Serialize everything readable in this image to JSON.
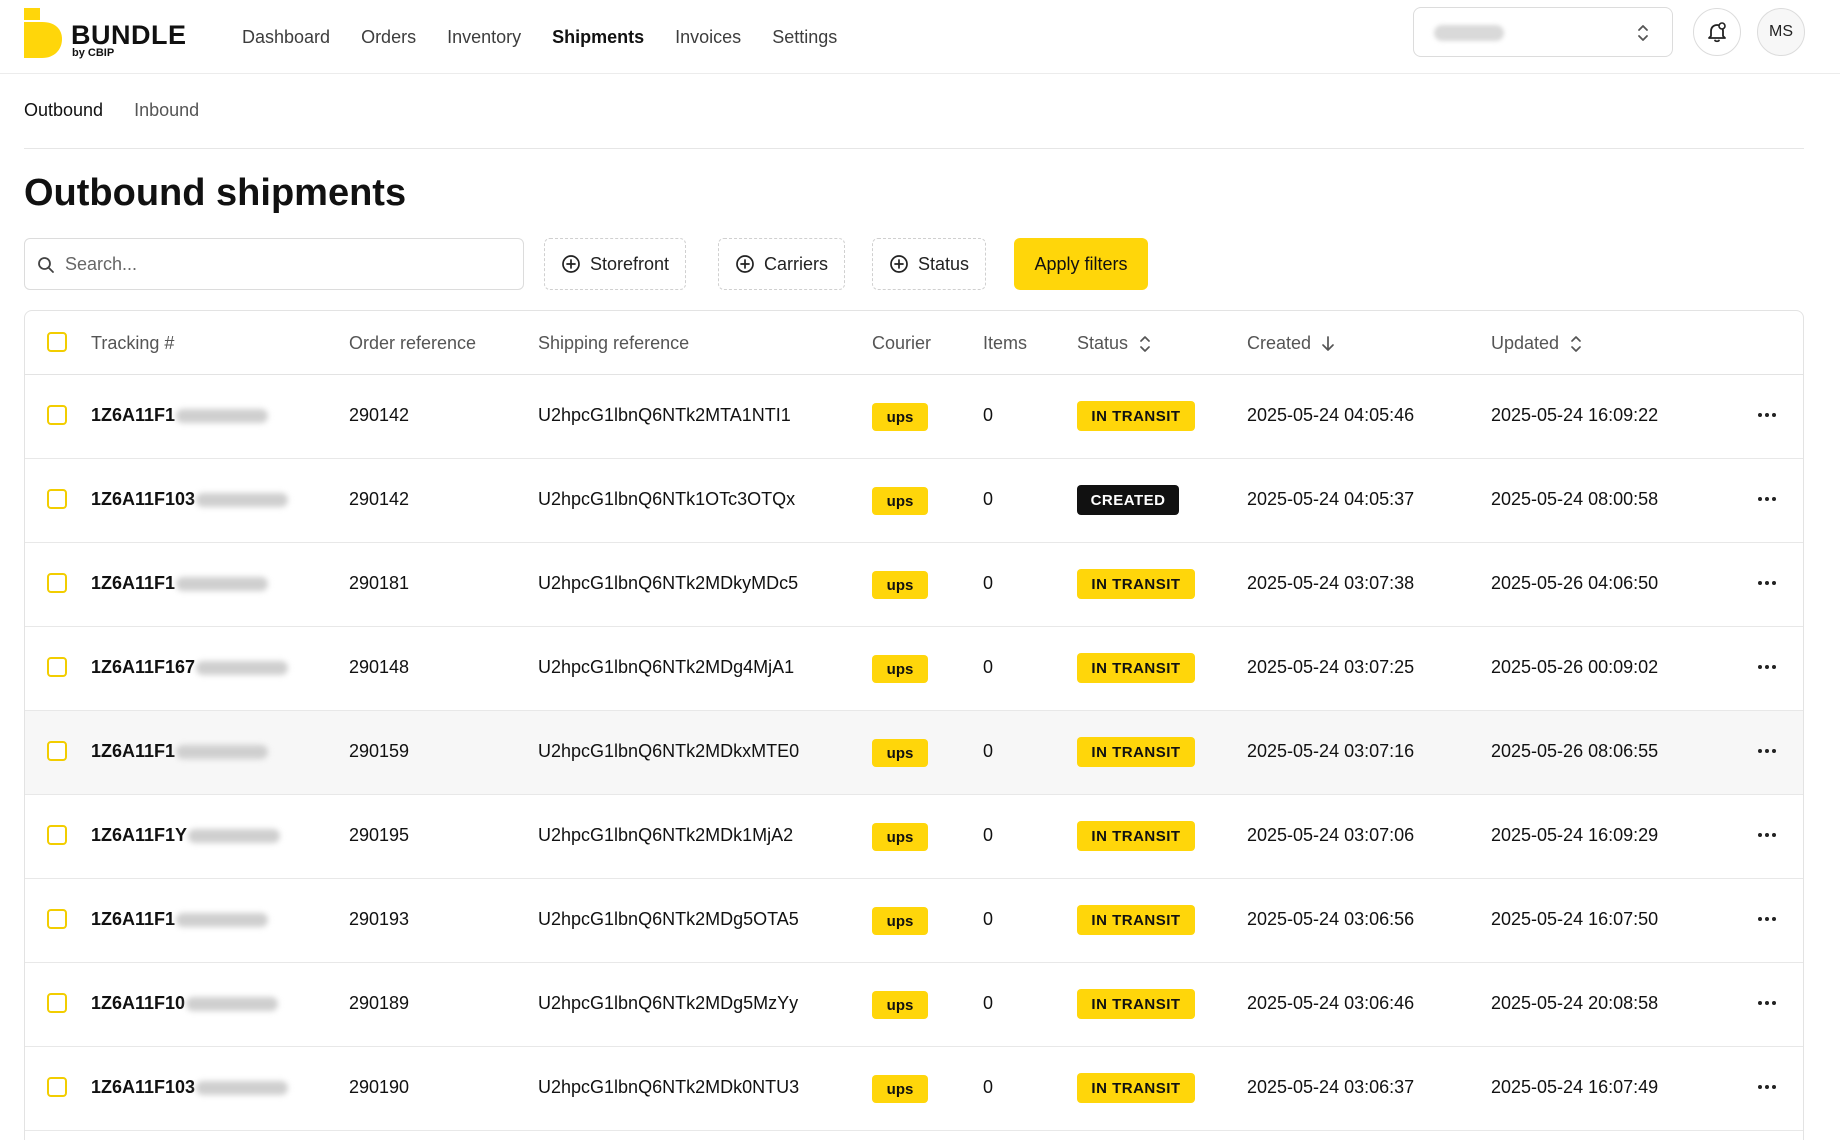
{
  "brand": {
    "name": "BUNDLE",
    "sub": "by CBIP"
  },
  "nav": [
    "Dashboard",
    "Orders",
    "Inventory",
    "Shipments",
    "Invoices",
    "Settings"
  ],
  "nav_active": "Shipments",
  "user": {
    "initials": "MS"
  },
  "subtabs": [
    "Outbound",
    "Inbound"
  ],
  "page_title": "Outbound shipments",
  "search": {
    "placeholder": "Search..."
  },
  "filters": [
    "Storefront",
    "Carriers",
    "Status"
  ],
  "apply_label": "Apply filters",
  "columns": {
    "tracking": "Tracking #",
    "order_ref": "Order reference",
    "shipping_ref": "Shipping reference",
    "courier": "Courier",
    "items": "Items",
    "status": "Status",
    "created": "Created",
    "updated": "Updated"
  },
  "rows": [
    {
      "tracking": "1Z6A11F1",
      "order_ref": "290142",
      "shipping_ref": "U2hpcG1lbnQ6NTk2MTA1NTI1",
      "courier": "ups",
      "items": "0",
      "status": "IN TRANSIT",
      "created": "2025-05-24 04:05:46",
      "updated": "2025-05-24 16:09:22"
    },
    {
      "tracking": "1Z6A11F103",
      "order_ref": "290142",
      "shipping_ref": "U2hpcG1lbnQ6NTk1OTc3OTQx",
      "courier": "ups",
      "items": "0",
      "status": "CREATED",
      "created": "2025-05-24 04:05:37",
      "updated": "2025-05-24 08:00:58"
    },
    {
      "tracking": "1Z6A11F1",
      "order_ref": "290181",
      "shipping_ref": "U2hpcG1lbnQ6NTk2MDkyMDc5",
      "courier": "ups",
      "items": "0",
      "status": "IN TRANSIT",
      "created": "2025-05-24 03:07:38",
      "updated": "2025-05-26 04:06:50"
    },
    {
      "tracking": "1Z6A11F167",
      "order_ref": "290148",
      "shipping_ref": "U2hpcG1lbnQ6NTk2MDg4MjA1",
      "courier": "ups",
      "items": "0",
      "status": "IN TRANSIT",
      "created": "2025-05-24 03:07:25",
      "updated": "2025-05-26 00:09:02"
    },
    {
      "tracking": "1Z6A11F1",
      "order_ref": "290159",
      "shipping_ref": "U2hpcG1lbnQ6NTk2MDkxMTE0",
      "courier": "ups",
      "items": "0",
      "status": "IN TRANSIT",
      "created": "2025-05-24 03:07:16",
      "updated": "2025-05-26 08:06:55"
    },
    {
      "tracking": "1Z6A11F1Y",
      "order_ref": "290195",
      "shipping_ref": "U2hpcG1lbnQ6NTk2MDk1MjA2",
      "courier": "ups",
      "items": "0",
      "status": "IN TRANSIT",
      "created": "2025-05-24 03:07:06",
      "updated": "2025-05-24 16:09:29"
    },
    {
      "tracking": "1Z6A11F1",
      "order_ref": "290193",
      "shipping_ref": "U2hpcG1lbnQ6NTk2MDg5OTA5",
      "courier": "ups",
      "items": "0",
      "status": "IN TRANSIT",
      "created": "2025-05-24 03:06:56",
      "updated": "2025-05-24 16:07:50"
    },
    {
      "tracking": "1Z6A11F10",
      "order_ref": "290189",
      "shipping_ref": "U2hpcG1lbnQ6NTk2MDg5MzYy",
      "courier": "ups",
      "items": "0",
      "status": "IN TRANSIT",
      "created": "2025-05-24 03:06:46",
      "updated": "2025-05-24 20:08:58"
    },
    {
      "tracking": "1Z6A11F103",
      "order_ref": "290190",
      "shipping_ref": "U2hpcG1lbnQ6NTk2MDk0NTU3",
      "courier": "ups",
      "items": "0",
      "status": "IN TRANSIT",
      "created": "2025-05-24 03:06:37",
      "updated": "2025-05-24 16:07:49"
    }
  ],
  "colors": {
    "accent": "#ffd60a",
    "created_badge": "#111111"
  },
  "icons": {
    "search": "search-icon",
    "filter": "plus-circle-icon",
    "sort": "sort-icon",
    "bell": "bell-icon",
    "more": "more-horizontal-icon"
  }
}
